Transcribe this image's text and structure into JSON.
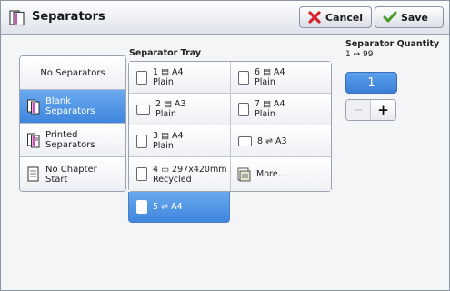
{
  "header": {
    "title": "Separators",
    "cancel_label": "Cancel",
    "save_label": "Save"
  },
  "options": [
    {
      "label_line1": "No Separators",
      "label_line2": "",
      "selected": false
    },
    {
      "label_line1": "Blank",
      "label_line2": "Separators",
      "selected": true
    },
    {
      "label_line1": "Printed",
      "label_line2": "Separators",
      "selected": false
    },
    {
      "label_line1": "No Chapter",
      "label_line2": "Start",
      "selected": false
    }
  ],
  "tray": {
    "title": "Separator Tray",
    "items": [
      {
        "line1": "1 ▤ A4",
        "line2": "Plain"
      },
      {
        "line1": "6 ▤ A4",
        "line2": "Plain"
      },
      {
        "line1": "2 ▤ A3",
        "line2": "Plain"
      },
      {
        "line1": "7 ▤ A4",
        "line2": "Plain"
      },
      {
        "line1": "3 ▤ A4",
        "line2": "Plain"
      },
      {
        "line1": "8 ⇌ A3",
        "line2": ""
      },
      {
        "line1": "4 ▭ 297x420mm",
        "line2": "Recycled"
      },
      {
        "line1": "More...",
        "line2": ""
      },
      {
        "line1": "5 ⇌ A4",
        "line2": "",
        "selected": true
      }
    ]
  },
  "quantity": {
    "title": "Separator Quantity",
    "range": "1 ↔ 99",
    "value": "1",
    "minus": "−",
    "plus": "+"
  },
  "colors": {
    "selected_blue": "#3f86de",
    "cancel_x": "#d9232a",
    "save_check": "#4a9a2a"
  }
}
